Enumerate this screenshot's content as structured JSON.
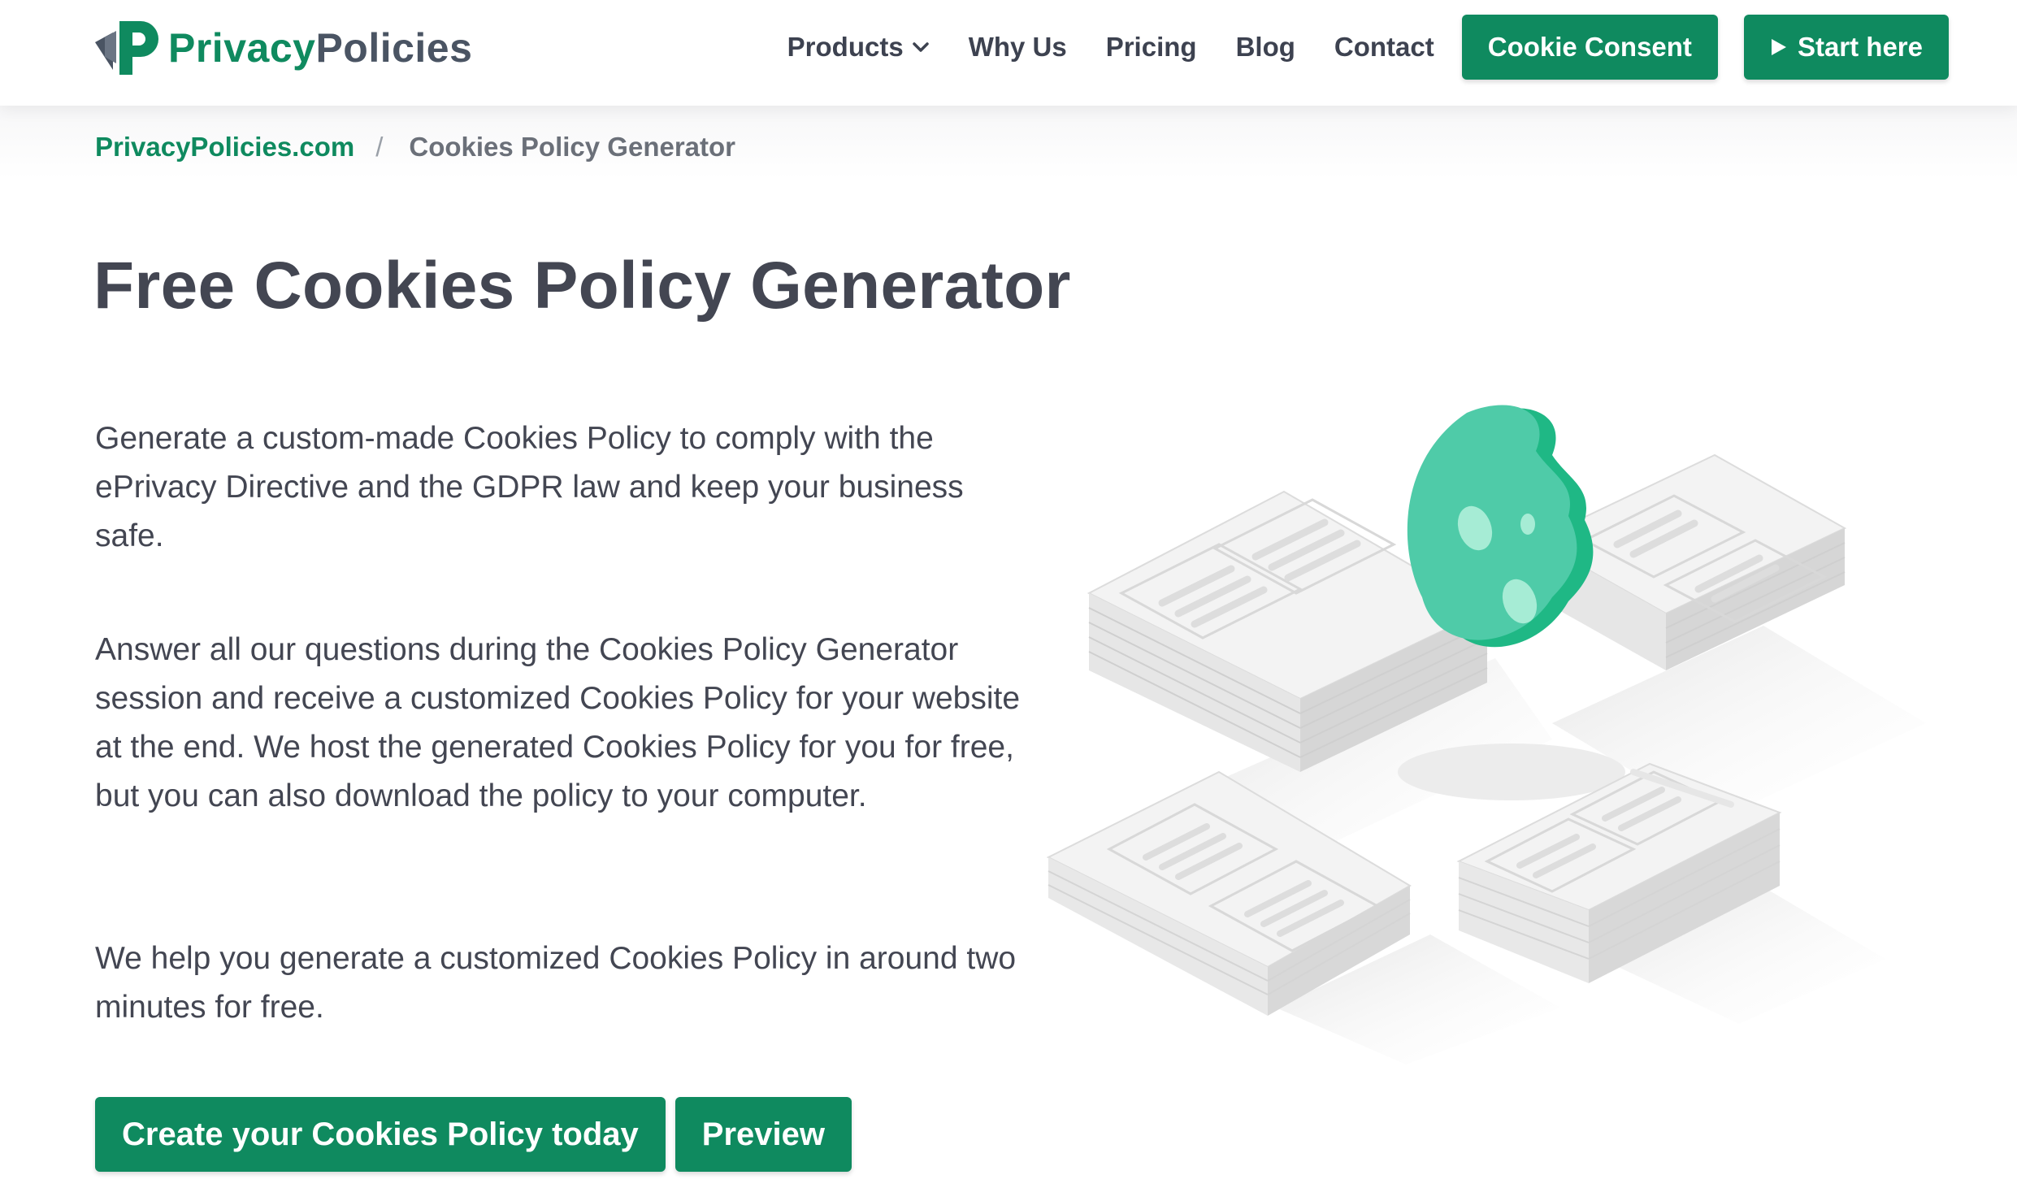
{
  "header": {
    "logo": {
      "text_part1": "Privacy",
      "text_part2": "Policies"
    },
    "nav": [
      {
        "label": "Products",
        "has_dropdown": true,
        "icon": "chevron-down-icon"
      },
      {
        "label": "Why Us"
      },
      {
        "label": "Pricing"
      },
      {
        "label": "Blog"
      },
      {
        "label": "Contact"
      }
    ],
    "cookie_consent_label": "Cookie Consent",
    "start_here_label": "Start here",
    "start_here_icon": "play-icon"
  },
  "breadcrumb": {
    "home": "PrivacyPolicies.com",
    "separator": "/",
    "current": "Cookies Policy Generator"
  },
  "main": {
    "title": "Free Cookies Policy Generator",
    "paragraphs": [
      "Generate a custom-made Cookies Policy to comply with the ePrivacy Directive and the GDPR law and keep your business safe.",
      "Answer all our questions during the Cookies Policy Generator session and receive a customized Cookies Policy for your website at the end. We host the generated Cookies Policy for you for free, but you can also download the policy to your computer.",
      "We help you generate a customized Cookies Policy in around two minutes for free."
    ],
    "cta_primary": "Create your Cookies Policy today",
    "cta_secondary": "Preview"
  },
  "illustration": {
    "icon": "cookie-documents-illustration"
  },
  "colors": {
    "brand_green": "#0f8a5f",
    "text_dark": "#434652",
    "cookie_green": "#4fcba8"
  }
}
